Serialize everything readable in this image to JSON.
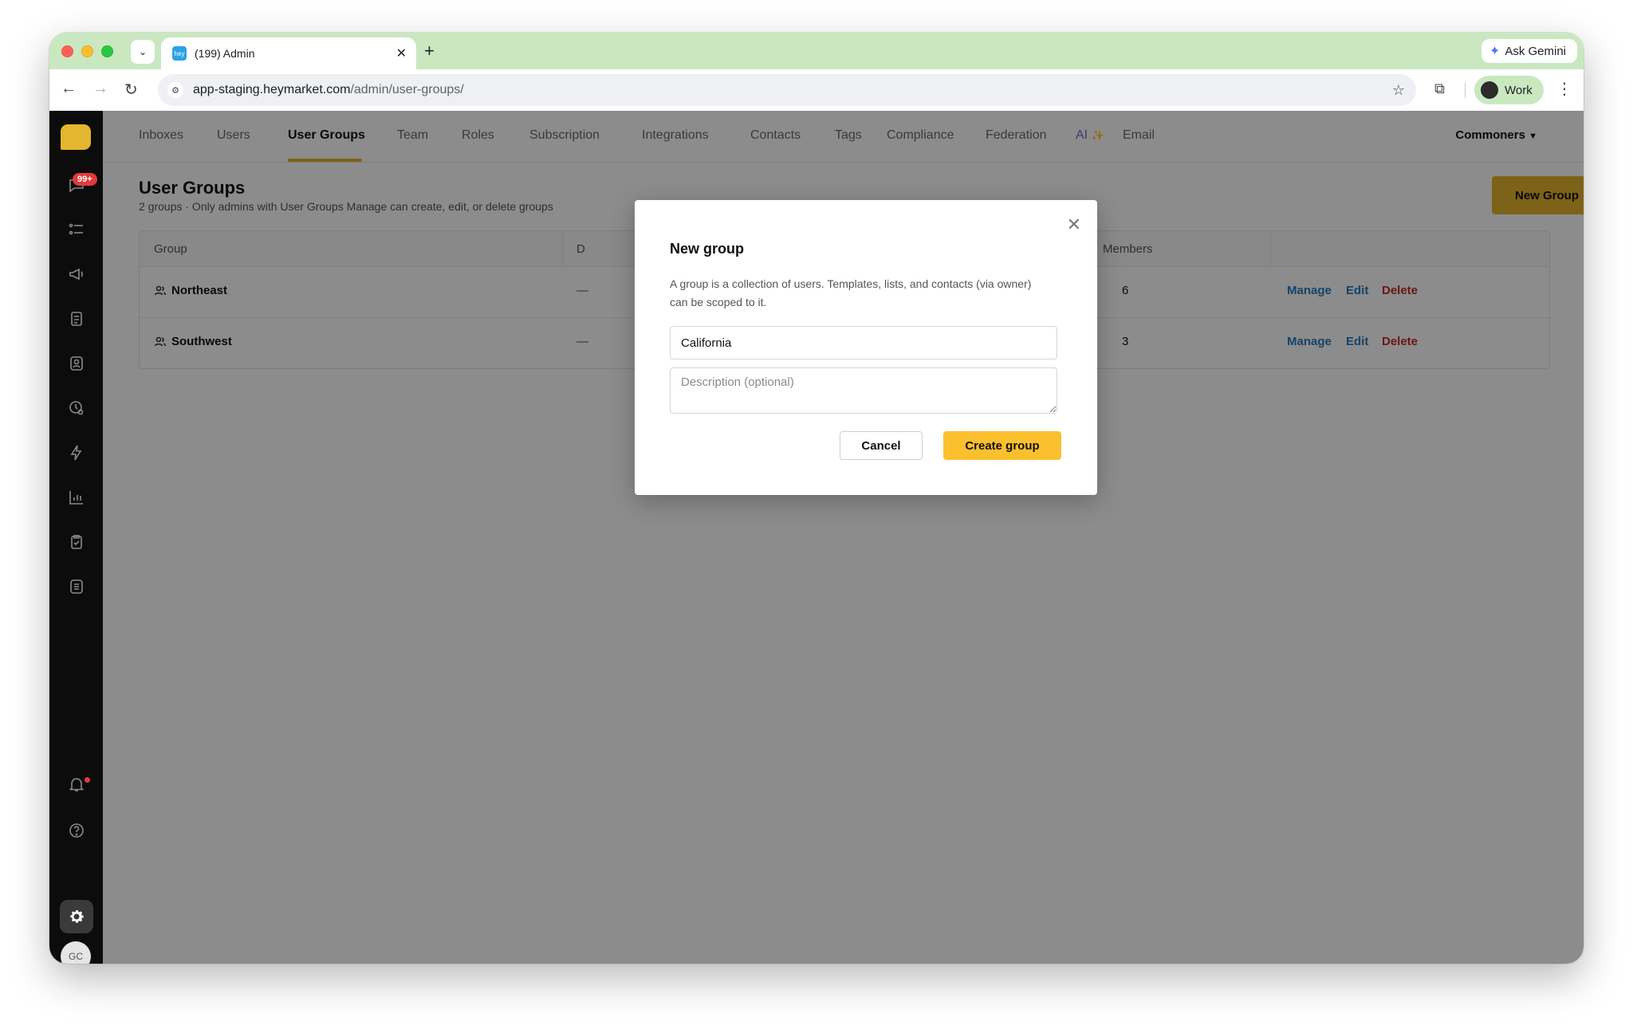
{
  "browser": {
    "tab_title": "(199) Admin",
    "tab_favicon_text": "hey",
    "new_tab_icon": "plus-icon",
    "ask_gemini_label": "Ask Gemini",
    "url_host": "app-staging.heymarket.com",
    "url_path": "/admin/user-groups/",
    "profile_label": "Work"
  },
  "sidebar": {
    "badge_count": "99+",
    "avatar_initials": "GC",
    "icons": [
      "chat-icon",
      "tasks-list-icon",
      "megaphone-icon",
      "documents-icon",
      "contacts-icon",
      "clock-user-icon",
      "lightning-icon",
      "bar-chart-icon",
      "clipboard-check-icon",
      "list-icon",
      "bell-icon",
      "help-icon",
      "gear-icon"
    ]
  },
  "topnav": {
    "items": [
      "Inboxes",
      "Users",
      "User Groups",
      "Team",
      "Roles",
      "Subscription",
      "Integrations",
      "Contacts",
      "Tags",
      "Compliance",
      "Federation",
      "AI",
      "Email"
    ],
    "ai_spark": "✨",
    "active": "User Groups",
    "workspace": "Commoners"
  },
  "page": {
    "title": "User Groups",
    "subtitle": "2 groups · Only admins with User Groups Manage can create, edit, or delete groups",
    "new_group_label": "New Group"
  },
  "table": {
    "columns": [
      "Group",
      "D",
      "Members"
    ],
    "rows": [
      {
        "name": "Northeast",
        "description": "—",
        "members": "6",
        "actions": [
          "Manage",
          "Edit",
          "Delete"
        ]
      },
      {
        "name": "Southwest",
        "description": "—",
        "members": "3",
        "actions": [
          "Manage",
          "Edit",
          "Delete"
        ]
      }
    ]
  },
  "modal": {
    "title": "New group",
    "description": "A group is a collection of users. Templates, lists, and contacts (via owner) can be scoped to it.",
    "name_value": "California",
    "description_placeholder": "Description (optional)",
    "cancel_label": "Cancel",
    "create_label": "Create group"
  },
  "colors": {
    "accent": "#e4b52e",
    "primary_button": "#fbc02d",
    "link": "#2a7bbf",
    "danger": "#c42828",
    "tab_strip": "#c9e8c0"
  }
}
